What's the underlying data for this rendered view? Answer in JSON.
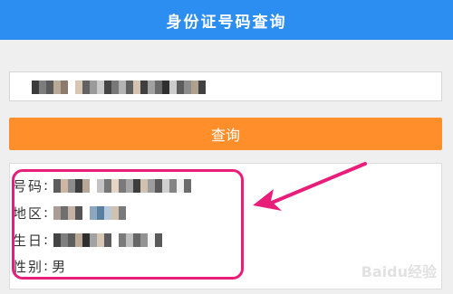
{
  "header": {
    "title": "身份证号码查询"
  },
  "search": {
    "value": ""
  },
  "query_button": {
    "label": "查询"
  },
  "result": {
    "id_label": "号码",
    "region_label": "地区",
    "birth_label": "生日",
    "gender_label": "性别",
    "gender_value": "男"
  },
  "watermark": {
    "text": "Baidu经验"
  },
  "colors": {
    "header": "#2d8ef2",
    "button": "#ff8e2b",
    "highlight": "#e91e7a"
  }
}
